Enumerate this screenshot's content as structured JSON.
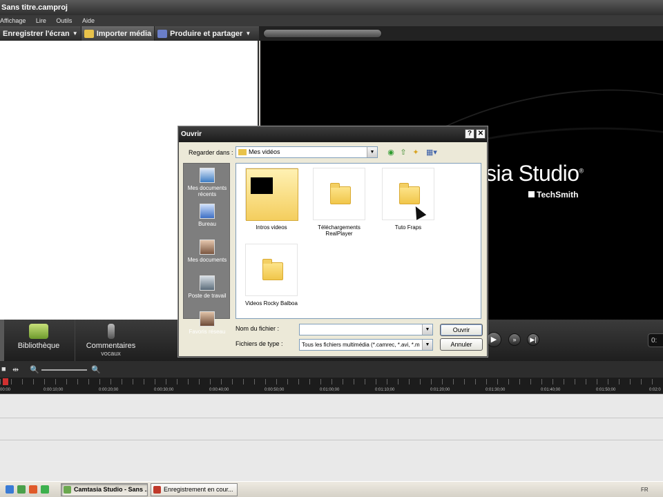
{
  "window": {
    "title": "Sans titre.camproj"
  },
  "menu": {
    "items": [
      "Affichage",
      "Lire",
      "Outils",
      "Aide"
    ]
  },
  "toolbar": {
    "record": "Enregistrer l'écran",
    "import": "Importer média",
    "produce": "Produire et partager"
  },
  "preview": {
    "brand": "sia Studio",
    "trademark": "®",
    "company": "TechSmith"
  },
  "tasks": {
    "library": "Bibliothèque",
    "comments_line1": "Commentaires",
    "comments_line2": "vocaux"
  },
  "player": {
    "time": "0:"
  },
  "timeline": {
    "ticks": [
      "00:00",
      "0:00:10;00",
      "0:00:20;00",
      "0:00:30;00",
      "0:00:40;00",
      "0:00:50;00",
      "0:01:00;00",
      "0:01:10;00",
      "0:01:20;00",
      "0:01:30;00",
      "0:01:40;00",
      "0:01:50;00",
      "0:02:0"
    ]
  },
  "dialog": {
    "title": "Ouvrir",
    "look_in_label": "Regarder dans :",
    "look_in_value": "Mes vidéos",
    "places": [
      {
        "label": "Mes documents récents",
        "color": "#3d7dc4"
      },
      {
        "label": "Bureau",
        "color": "#3d6fc4"
      },
      {
        "label": "Mes documents",
        "color": "#b68a6c"
      },
      {
        "label": "Poste de travail",
        "color": "#8d8d8d"
      },
      {
        "label": "Favoris réseau",
        "color": "#9c7a62"
      }
    ],
    "files": [
      {
        "name": "Intros videos"
      },
      {
        "name": "Téléchargements RealPlayer"
      },
      {
        "name": "Tuto Fraps"
      },
      {
        "name": "Videos Rocky Balboa"
      }
    ],
    "filename_label": "Nom du fichier :",
    "filename_value": "",
    "filetype_label": "Fichiers de type :",
    "filetype_value": "Tous les fichiers multimédia (*.camrec, *.avi, *.m",
    "open_button": "Ouvrir",
    "cancel_button": "Annuler",
    "help_glyph": "?",
    "close_glyph": "✕"
  },
  "taskbar": {
    "tasks": [
      "Camtasia Studio - Sans ...",
      "Enregistrement en cour..."
    ],
    "tray": "FR"
  }
}
